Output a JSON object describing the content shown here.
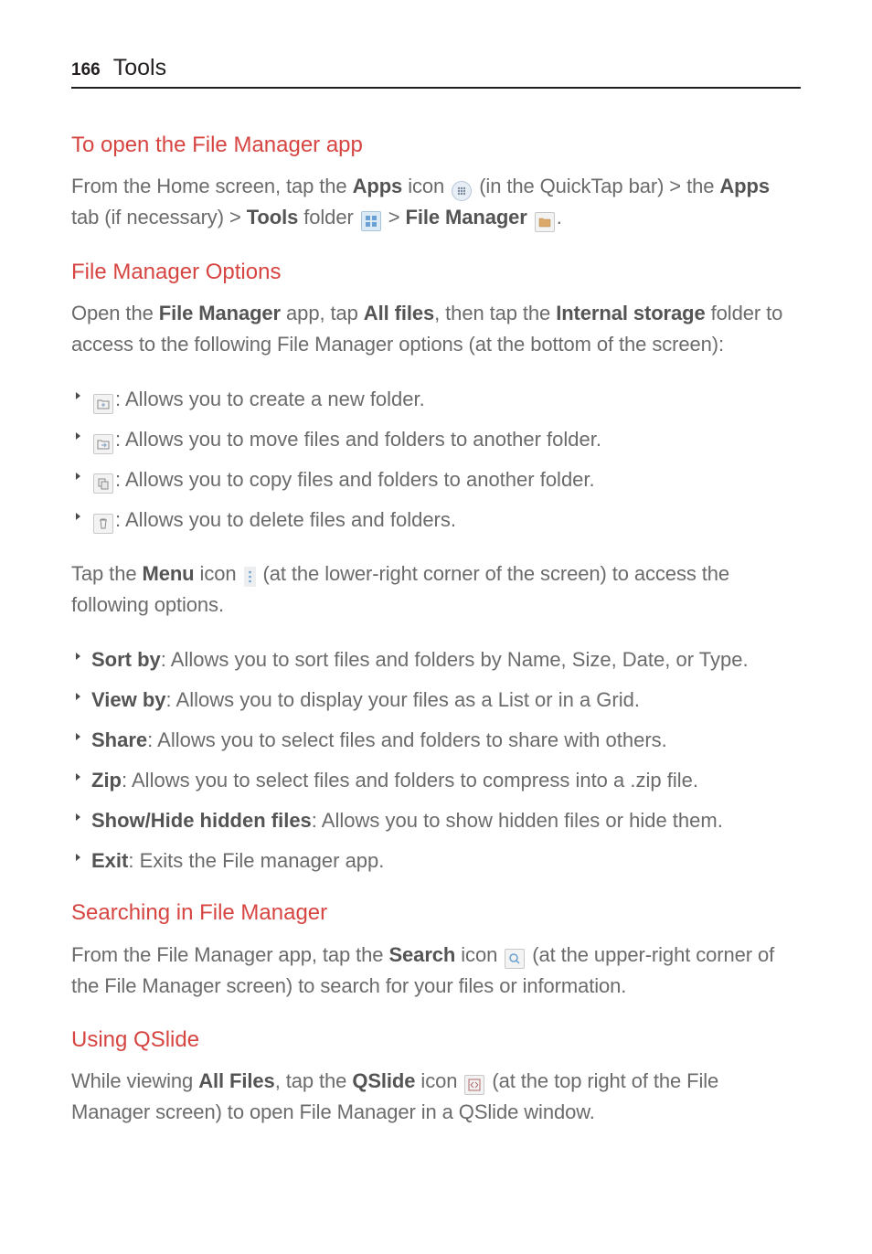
{
  "header": {
    "page_number": "166",
    "title": "Tools"
  },
  "sections": {
    "open": {
      "title": "To open the File Manager app",
      "p1_a": "From the Home screen, tap the ",
      "p1_b": "Apps",
      "p1_c": " icon ",
      "p1_d": " (in the QuickTap bar) > the ",
      "p1_e": "Apps",
      "p1_f": " tab (if necessary) > ",
      "p1_g": "Tools",
      "p1_h": " folder ",
      "p1_i": " > ",
      "p1_j": "File Manager",
      "p1_k": " ",
      "p1_l": "."
    },
    "options": {
      "title": "File Manager Options",
      "p1_a": "Open the ",
      "p1_b": "File Manager",
      "p1_c": " app, tap ",
      "p1_d": "All files",
      "p1_e": ", then tap the ",
      "p1_f": "Internal storage",
      "p1_g": " folder to access to the following File Manager options (at the bottom of the screen):",
      "bullets1": {
        "b1": ": Allows you to create a new folder.",
        "b2": ": Allows you to move files and folders to another folder.",
        "b3": ": Allows you to copy files and folders to another folder.",
        "b4": ": Allows you to delete files and folders."
      },
      "p2_a": "Tap the ",
      "p2_b": "Menu",
      "p2_c": " icon ",
      "p2_d": " (at the lower-right corner of the screen) to access the following options.",
      "bullets2": {
        "b1_bold": "Sort by",
        "b1_rest": ": Allows you to sort files and folders by Name, Size, Date, or Type.",
        "b2_bold": "View by",
        "b2_rest": ": Allows you to display your files as a List or in a Grid.",
        "b3_bold": "Share",
        "b3_rest": ": Allows you to select files and folders to share with others.",
        "b4_bold": "Zip",
        "b4_rest": ": Allows you to select files and folders to compress into a .zip file.",
        "b5_bold": "Show/Hide hidden files",
        "b5_rest": ": Allows you to show hidden files or hide them.",
        "b6_bold": "Exit",
        "b6_rest": ": Exits the File manager app."
      }
    },
    "searching": {
      "title": "Searching in File Manager",
      "p1_a": "From the File Manager app, tap the ",
      "p1_b": "Search",
      "p1_c": " icon ",
      "p1_d": " (at the upper-right corner of the File Manager screen) to search for your files or information."
    },
    "qslide": {
      "title": "Using QSlide",
      "p1_a": "While viewing ",
      "p1_b": "All Files",
      "p1_c": ", tap the ",
      "p1_d": "QSlide",
      "p1_e": " icon ",
      "p1_f": " (at the top right of the File Manager screen) to open File Manager in a QSlide window."
    }
  }
}
